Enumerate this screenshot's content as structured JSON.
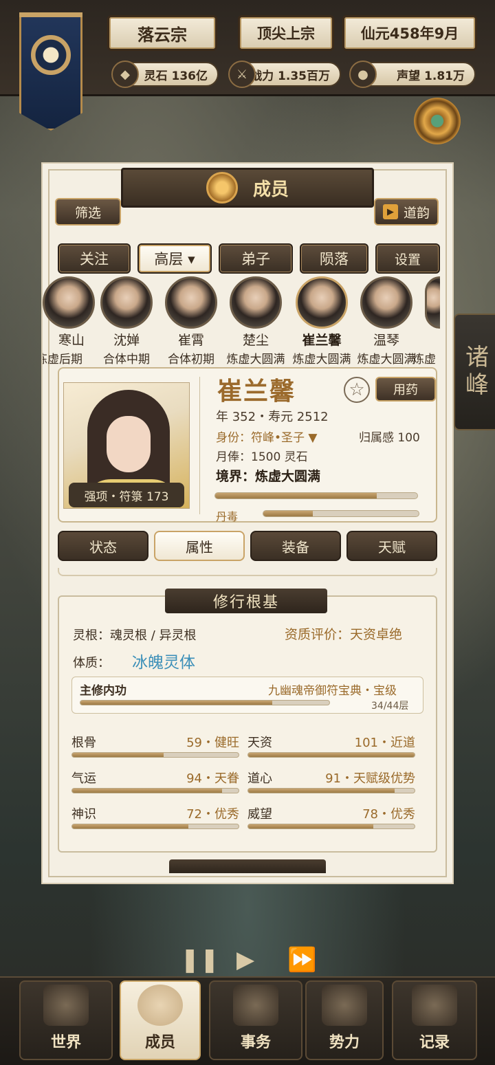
{
  "top": {
    "sect_name": "落云宗",
    "rank": "顶尖上宗",
    "date": "仙元458年9月",
    "stats": [
      {
        "icon": "spirit-stone-icon",
        "glyph": "◆",
        "label": "灵石 136亿"
      },
      {
        "icon": "sword-icon",
        "glyph": "⚔",
        "label": "战力 1.35百万"
      },
      {
        "icon": "prestige-icon",
        "glyph": "●",
        "label": "声望 1.81万"
      }
    ]
  },
  "side_tab": "诸峰",
  "panel": {
    "title": "成员",
    "filter_label": "筛选",
    "daoyun_label": "道韵",
    "tabs": [
      "关注",
      "高层 ▾",
      "弟子",
      "陨落",
      "设置"
    ],
    "members": [
      {
        "name": "寒山",
        "realm": "炼虚后期"
      },
      {
        "name": "沈婵",
        "realm": "合体中期"
      },
      {
        "name": "崔霄",
        "realm": "合体初期"
      },
      {
        "name": "楚尘",
        "realm": "炼虚大圆满"
      },
      {
        "name": "崔兰馨",
        "realm": "炼虚大圆满"
      },
      {
        "name": "温琴",
        "realm": "炼虚大圆满"
      },
      {
        "name": "…",
        "realm": "炼虚"
      }
    ],
    "detail": {
      "name": "崔兰馨",
      "use_med_label": "用药",
      "strength": "强项・符箓 173",
      "age_line": "年 352・寿元 2512",
      "identity": "身份：符峰•圣子 ▼",
      "belonging": "归属感 100",
      "salary": "月俸：1500 灵石",
      "realm": "境界：炼虚大圆满",
      "realm_progress": 0.8,
      "poison_label": "丹毒",
      "poison_progress": 0.32
    },
    "sub_tabs": [
      "状态",
      "属性",
      "装备",
      "天赋"
    ],
    "section_title": "修行根基",
    "root": "灵根：魂灵根 / 异灵根",
    "rating": "资质评价：天资卓绝",
    "physique_label": "体质：",
    "physique": "冰魄灵体",
    "technique_label": "主修内功",
    "technique": "九幽魂帝御符宝典・宝级",
    "technique_progress_text": "34/44层",
    "technique_progress": 0.77,
    "attributes": [
      {
        "k": "根骨",
        "v": "59・健旺",
        "p": 0.55
      },
      {
        "k": "天资",
        "v": "101・近道",
        "p": 1.0
      },
      {
        "k": "气运",
        "v": "94・天眷",
        "p": 0.9
      },
      {
        "k": "道心",
        "v": "91・天赋级优势",
        "p": 0.88
      },
      {
        "k": "神识",
        "v": "72・优秀",
        "p": 0.7
      },
      {
        "k": "威望",
        "v": "78・优秀",
        "p": 0.75
      }
    ]
  },
  "nav": [
    {
      "label": "世界",
      "icon": "world-icon"
    },
    {
      "label": "成员",
      "icon": "member-icon"
    },
    {
      "label": "事务",
      "icon": "affairs-icon"
    },
    {
      "label": "势力",
      "icon": "faction-icon"
    },
    {
      "label": "记录",
      "icon": "record-icon"
    }
  ],
  "colors": {
    "gold": "#9a6a2a",
    "dark": "#3a2f24",
    "paper": "#f4efe3",
    "physique": "#3b8fb8"
  }
}
